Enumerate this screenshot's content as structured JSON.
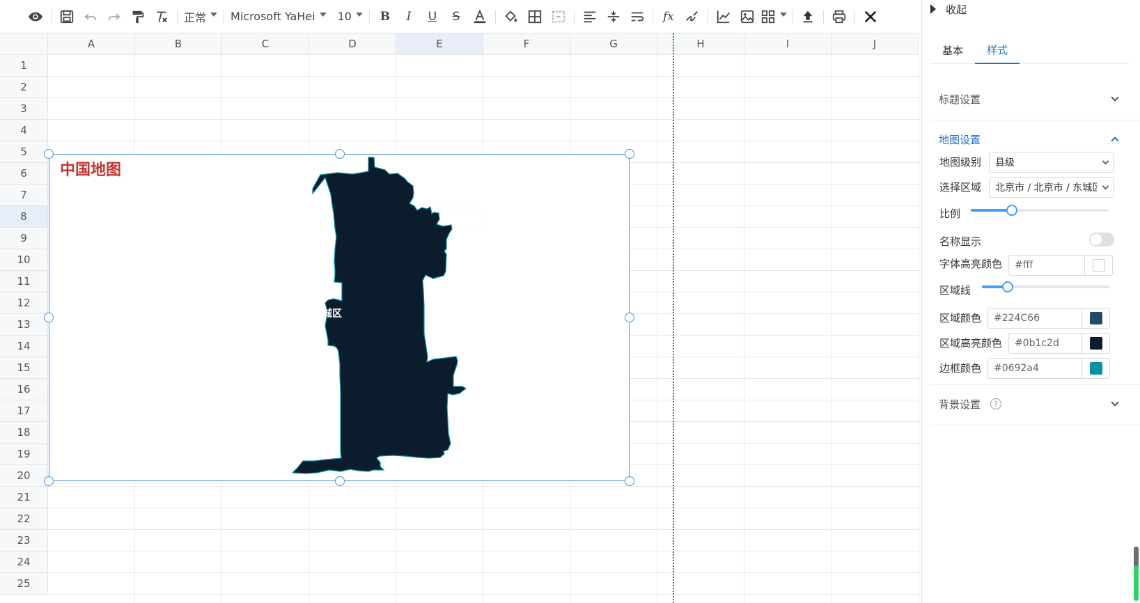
{
  "toolbar": {
    "style_value": "正常",
    "font_value": "Microsoft YaHei",
    "size_value": "10"
  },
  "grid": {
    "columns": [
      "A",
      "B",
      "C",
      "D",
      "E",
      "F",
      "G",
      "H",
      "I",
      "J"
    ],
    "rows": [
      "1",
      "2",
      "3",
      "4",
      "5",
      "6",
      "7",
      "8",
      "9",
      "10",
      "11",
      "12",
      "13",
      "14",
      "15",
      "16",
      "17",
      "18",
      "19",
      "20",
      "21",
      "22",
      "23",
      "24",
      "25"
    ],
    "selected_column": "E",
    "selected_row": "8"
  },
  "chart": {
    "title": "中国地图",
    "region_label": "东城区",
    "title_color": "#c23531"
  },
  "panel": {
    "collapse_label": "收起",
    "tabs": [
      "基本",
      "样式"
    ],
    "active_tab": "样式",
    "sections": {
      "title_settings": "标题设置",
      "map_settings": "地图设置",
      "background_settings": "背景设置"
    },
    "map_settings": {
      "level_label": "地图级别",
      "level_value": "县级",
      "region_label": "选择区域",
      "region_value": "北京市 / 北京市 / 东城区",
      "scale_label": "比例",
      "scale_fraction": 0.3,
      "name_display_label": "名称显示",
      "name_display_on": false,
      "font_highlight_label": "字体高亮颜色",
      "font_highlight_value": "#fff",
      "area_line_label": "区域线",
      "area_line_fraction": 0.2,
      "area_color_label": "区域颜色",
      "area_color_value": "#224C66",
      "area_highlight_label": "区域高亮颜色",
      "area_highlight_value": "#0b1c2d",
      "border_color_label": "边框颜色",
      "border_color_value": "#0692a4"
    }
  },
  "colors": {
    "accent": "#1f6fd0",
    "map_fill": "#0b1c2d",
    "map_border": "#0692a4"
  }
}
